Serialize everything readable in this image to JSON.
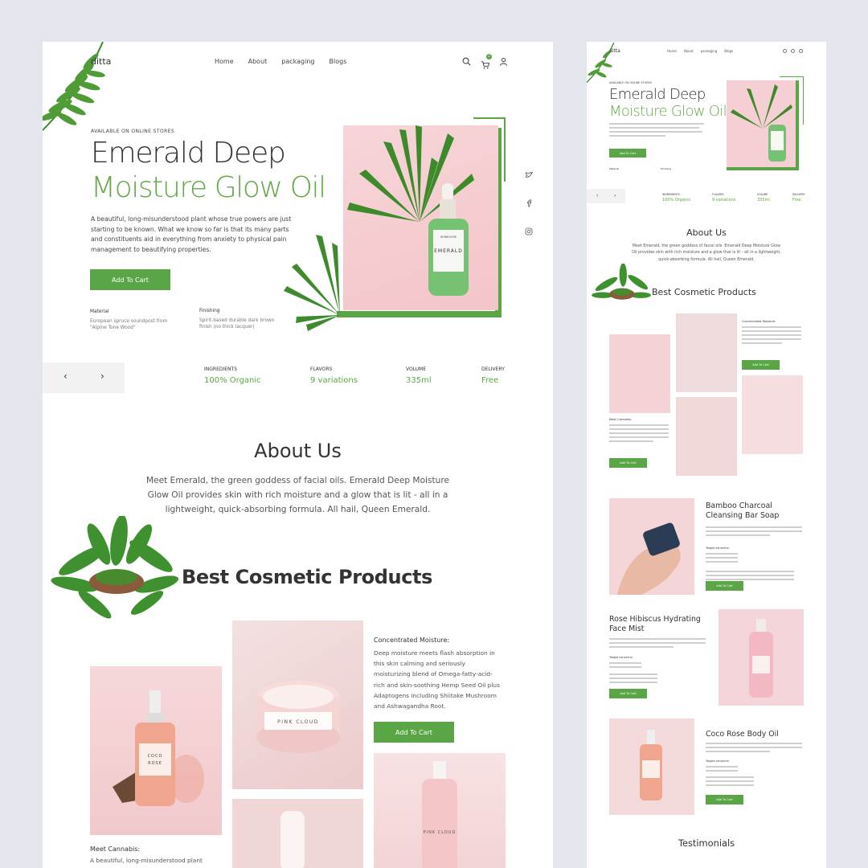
{
  "colors": {
    "accent": "#5aa646",
    "heading_green": "#64a84a",
    "background": "#e3e7ed",
    "product_pink": "#f3d0d2"
  },
  "main": {
    "logo": "ditta",
    "nav": [
      "Home",
      "About",
      "packaging",
      "Blogs"
    ],
    "icons": [
      "search-icon",
      "cart-icon",
      "user-icon"
    ],
    "cart_badge": "2",
    "hero": {
      "eyebrow": "AVAILABLE ON ONLINE STORES",
      "title_dark": "Emerald Deep",
      "title_green": "Moisture Glow Oil",
      "description": "A beautiful, long-misunderstood plant whose true powers are just starting to be known. What we know so far is that its many parts and constituents aid in everything from anxiety to physical pain management to beautifying properties.",
      "cta": "Add To Cart",
      "bottle_brand": "HERBIVORE",
      "bottle_name": "EMERALD",
      "specs": [
        {
          "label": "Material",
          "value": "European spruce soundpost from \"Alpine Tone Wood\""
        },
        {
          "label": "Finishing",
          "value": "Spirit-based durable dark brown finish (no thick lacquer)"
        }
      ]
    },
    "social": [
      "twitter-icon",
      "facebook-icon",
      "instagram-icon"
    ],
    "slider": {
      "prev": "‹",
      "next": "›"
    },
    "stats": [
      {
        "label": "INGREDIENTS",
        "value": "100% Organic"
      },
      {
        "label": "FLAVORS",
        "value": "9 variations"
      },
      {
        "label": "VOLUME",
        "value": "335ml"
      },
      {
        "label": "DELIVERY",
        "value": "Free"
      }
    ],
    "about": {
      "title": "About Us",
      "text": "Meet Emerald, the green goddess of facial oils. Emerald Deep Moisture Glow Oil provides skin with rich moisture and a glow that is lit - all in a lightweight, quick-absorbing formula. All hail, Queen Emerald."
    },
    "best_title": "Best Cosmetic Products",
    "products": {
      "concentrated_title": "Concentrated Moisture:",
      "concentrated_text": "Deep moisture meets flash absorption in this skin calming and seriously moisturizing blend of Omega-fatty-acid-rich and skin-soothing Hemp Seed Oil plus Adaptogens including Shiitake Mushroom and Ashwagandha Root.",
      "concentrated_cta": "Add To Cart",
      "cannabis_title": "Meet Cannabis:",
      "cannabis_text": "A beautiful, long-misunderstood plant",
      "coco_label_1": "COCO",
      "coco_label_2": "ROSE",
      "cloud_label_1": "PINK CLOUD",
      "cloud_label_2": "PINK CLOUD"
    }
  },
  "preview": {
    "logo": "ditta",
    "nav": [
      "Home",
      "About",
      "packaging",
      "Blogs"
    ],
    "eyebrow": "AVAILABLE ON ONLINE STORES",
    "title_dark": "Emerald Deep",
    "title_green": "Moisture Glow Oil",
    "cta": "Add To Cart",
    "specs": [
      "Material",
      "Finishing"
    ],
    "stats": [
      {
        "label": "INGREDIENTS",
        "value": "100% Organic"
      },
      {
        "label": "FLAVORS",
        "value": "9 variations"
      },
      {
        "label": "VOLUME",
        "value": "335ml"
      },
      {
        "label": "DELIVERY",
        "value": "Free"
      }
    ],
    "about_title": "About Us",
    "about_text": "Meet Emerald, the green goddess of facial oils. Emerald Deep Moisture Glow Oil provides skin with rich moisture and a glow that is lit - all in a lightweight, quick-absorbing formula. All hail, Queen Emerald.",
    "best_title": "Best Cosmetic Products",
    "concentrated_title": "Concentrated Moisture:",
    "cannabis_title": "Meet Cannabis:",
    "product_1": "Bamboo Charcoal Cleansing Bar Soap",
    "product_2": "Rose Hibiscus Hydrating Face Mist",
    "product_3": "Coco Rose Body Oil",
    "target_label": "Target concerns:",
    "testimonials": "Testimonials"
  }
}
